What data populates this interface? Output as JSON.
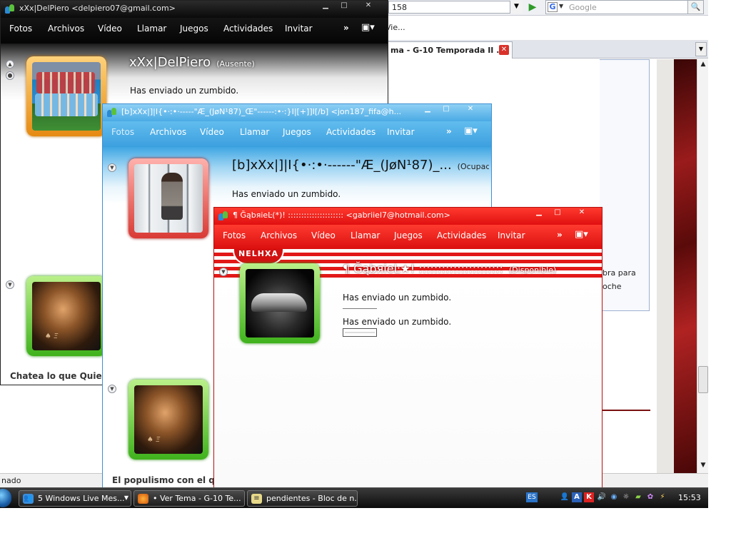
{
  "browser": {
    "url_fragment": "158",
    "google_placeholder": "Google",
    "bookmark_text": "Vie...",
    "tab_title": "ma - G-10 Temporada II ...",
    "page_text_1": "bra para",
    "page_text_2": "oche",
    "status_text": "nado"
  },
  "windows": {
    "w1": {
      "title": "xXx|DelPiero <delpiero07@gmail.com>",
      "menu": [
        "Fotos",
        "Archivos",
        "Vídeo",
        "Llamar",
        "Juegos",
        "Actividades",
        "Invitar"
      ],
      "contact_name": "xXx|DelPiero",
      "contact_status": "(Ausente)",
      "message": "Has enviado un zumbido.",
      "personal_message": "Chatea lo que Quieras c"
    },
    "w2": {
      "title": "[b]xXx|]|I{•·:•·-----\"Æ_(JøN¹87)_Œ\"------:•·:}I|[+]]I[/b] <jon187_fifa@h...",
      "menu": [
        "Fotos",
        "Archivos",
        "Vídeo",
        "Llamar",
        "Juegos",
        "Actividades",
        "Invitar"
      ],
      "contact_name": "[b]xXx|]|I{•·:•·------\"Æ_(JøN¹87)_...",
      "contact_status": "(Ocupado)",
      "message": "Has enviado un zumbido.",
      "personal_message": "El populismo con el que g"
    },
    "w3": {
      "title": "¶ ĞąbяieĿ(*)! ::::::::::::::::::::: <gabriiel7@hotmail.com>",
      "menu": [
        "Fotos",
        "Archivos",
        "Vídeo",
        "Llamar",
        "Juegos",
        "Actividades",
        "Invitar"
      ],
      "banner": "NELHXA",
      "contact_name": "¶ ĞąbяieĿ★! ::::::::::::::::::::::",
      "contact_status": "(Disponible)",
      "message_1": "Has enviado un zumbido.",
      "message_2": "Has enviado un zumbido."
    }
  },
  "taskbar": {
    "items": [
      {
        "label": "5 Windows Live Mes...",
        "icon": "messenger-icon"
      },
      {
        "label": "• Ver Tema - G-10 Te...",
        "icon": "firefox-icon"
      },
      {
        "label": "pendientes - Bloc de n...",
        "icon": "notepad-icon"
      }
    ],
    "language": "ES",
    "clock": "15:53"
  },
  "colors": {
    "w1_theme": "#0a0a0a",
    "w2_theme": "#4aaae4",
    "w3_theme": "#e01010",
    "taskbar": "#1a1a1a"
  }
}
